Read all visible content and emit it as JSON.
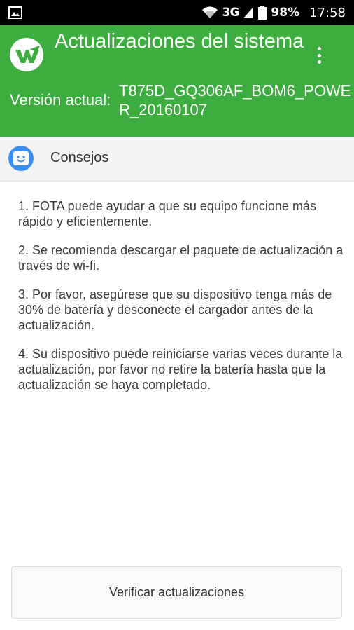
{
  "status_bar": {
    "network": "3G",
    "battery": "98%",
    "time": "17:58",
    "icons": [
      "gallery-icon",
      "wifi-icon",
      "signal-icon",
      "battery-icon"
    ]
  },
  "header": {
    "title": "Actualizaciones del sistema",
    "version_label": "Versión actual:",
    "version_value": "T875D_GQ306AF_BOM6_POWER_20160107",
    "logo_icon": "update-logo-icon",
    "menu_icon": "overflow-menu-icon"
  },
  "tips": {
    "title": "Consejos",
    "icon": "smiley-face-icon",
    "items": [
      "1. FOTA puede ayudar a que su equipo funcione más rápido y eficientemente.",
      "2. Se recomienda descargar el paquete de actualización a través de wi-fi.",
      "3. Por favor, asegúrese que su dispositivo tenga más de 30% de batería y desconecte el cargador antes de la actualización.",
      "4. Su dispositivo puede reiniciarse varias veces durante la actualización, por favor no retire la batería hasta que la actualización se haya completado."
    ]
  },
  "button": {
    "label": "Verificar actualizaciones"
  },
  "colors": {
    "header_bg": "#3dad3f",
    "status_bar_bg": "#000000",
    "tips_icon_bg": "#3b8ef0",
    "tips_bar_bg": "#f3f3f3"
  }
}
